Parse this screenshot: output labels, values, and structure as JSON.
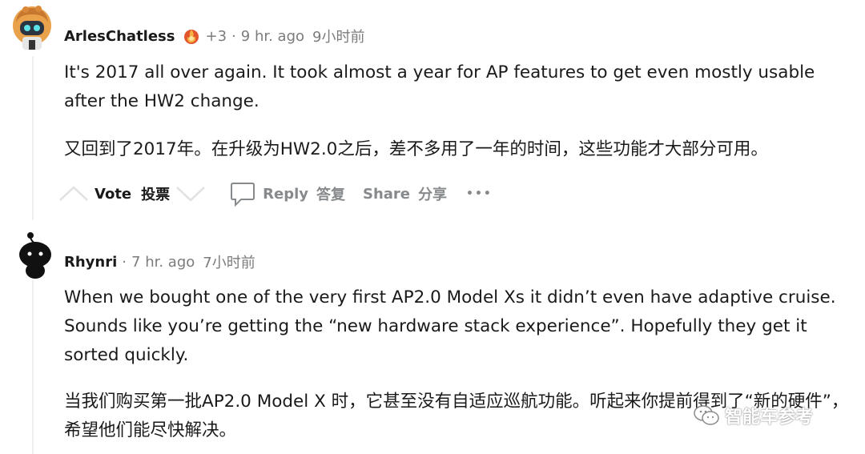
{
  "comments": [
    {
      "username": "ArlesChatless",
      "score": "+3",
      "time_en": "9 hr. ago",
      "time_cn": "9小时前",
      "text_en": "It's 2017 all over again. It took almost a year for AP features to get even mostly usable after the HW2 change.",
      "text_cn": "又回到了2017年。在升级为HW2.0之后，差不多用了一年的时间，这些功能才大部分可用。"
    },
    {
      "username": "Rhynri",
      "time_en": "7 hr. ago",
      "time_cn": "7小时前",
      "text_en": "When we bought one of the very first AP2.0 Model Xs it didn’t even have adaptive cruise. Sounds like you’re getting the “new hardware stack experience”. Hopefully they get it sorted quickly.",
      "text_cn": "当我们购买第一批AP2.0 Model X 时，它甚至没有自适应巡航功能。听起来你提前得到了“新的硬件”，希望他们能尽快解决。"
    }
  ],
  "actions": {
    "vote_label": "Vote",
    "vote_cn": "投票",
    "reply_label": "Reply",
    "reply_cn": "答复",
    "share_label": "Share",
    "share_cn": "分享",
    "more": "•••"
  },
  "watermark": {
    "text": "智能车参考"
  }
}
